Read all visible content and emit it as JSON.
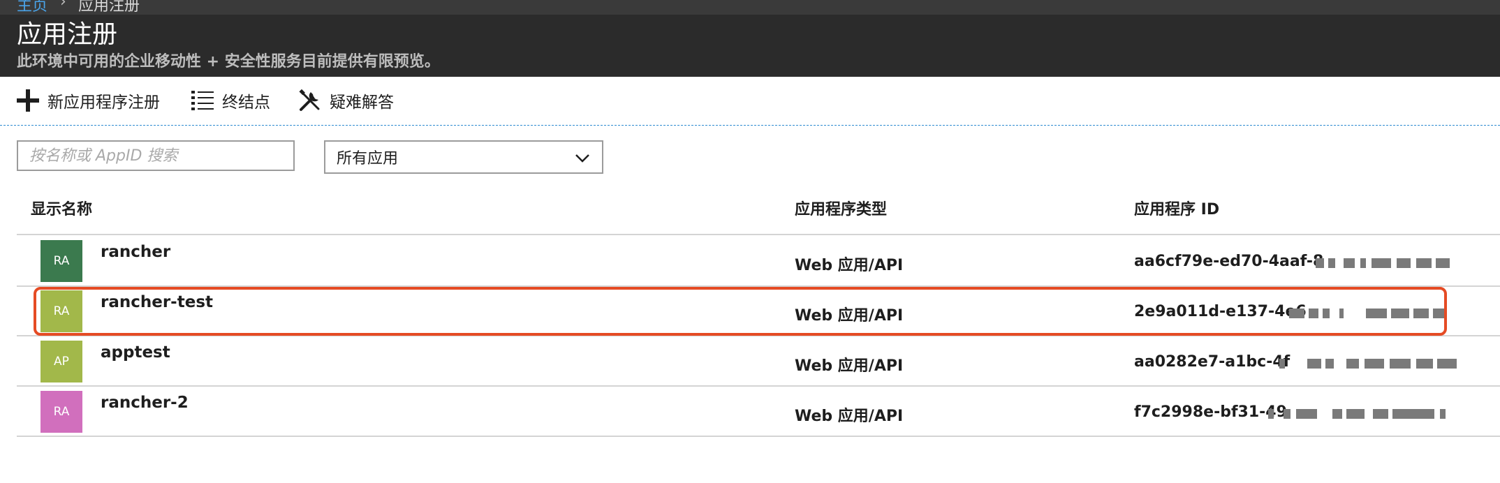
{
  "breadcrumb": {
    "home": "主页",
    "separator": "›",
    "current": "应用注册"
  },
  "page": {
    "title": "应用注册",
    "subtitle": "此环境中可用的企业移动性 + 安全性服务目前提供有限预览。"
  },
  "toolbar": {
    "new_registration": "新应用程序注册",
    "endpoints": "终结点",
    "troubleshoot": "疑难解答"
  },
  "filters": {
    "search_placeholder": "按名称或 AppID 搜索",
    "search_value": "",
    "app_filter_selected": "所有应用"
  },
  "table": {
    "columns": [
      "显示名称",
      "应用程序类型",
      "应用程序 ID"
    ],
    "rows": [
      {
        "initials": "RA",
        "name": "rancher",
        "type": "Web 应用/API",
        "app_id": "aa6cf79e-ed70-4aaf-8",
        "avatar_color": "#3b7a4e"
      },
      {
        "initials": "RA",
        "name": "rancher-test",
        "type": "Web 应用/API",
        "app_id": "2e9a011d-e137-4e6",
        "avatar_color": "#a2b84a"
      },
      {
        "initials": "AP",
        "name": "apptest",
        "type": "Web 应用/API",
        "app_id": "aa0282e7-a1bc-4f",
        "avatar_color": "#a2b84a"
      },
      {
        "initials": "RA",
        "name": "rancher-2",
        "type": "Web 应用/API",
        "app_id": "f7c2998e-bf31-49",
        "avatar_color": "#d16fbd"
      }
    ]
  },
  "colors": {
    "header_bg": "#2b2b2b",
    "link": "#4aa3e8",
    "highlight": "#e54b24"
  }
}
